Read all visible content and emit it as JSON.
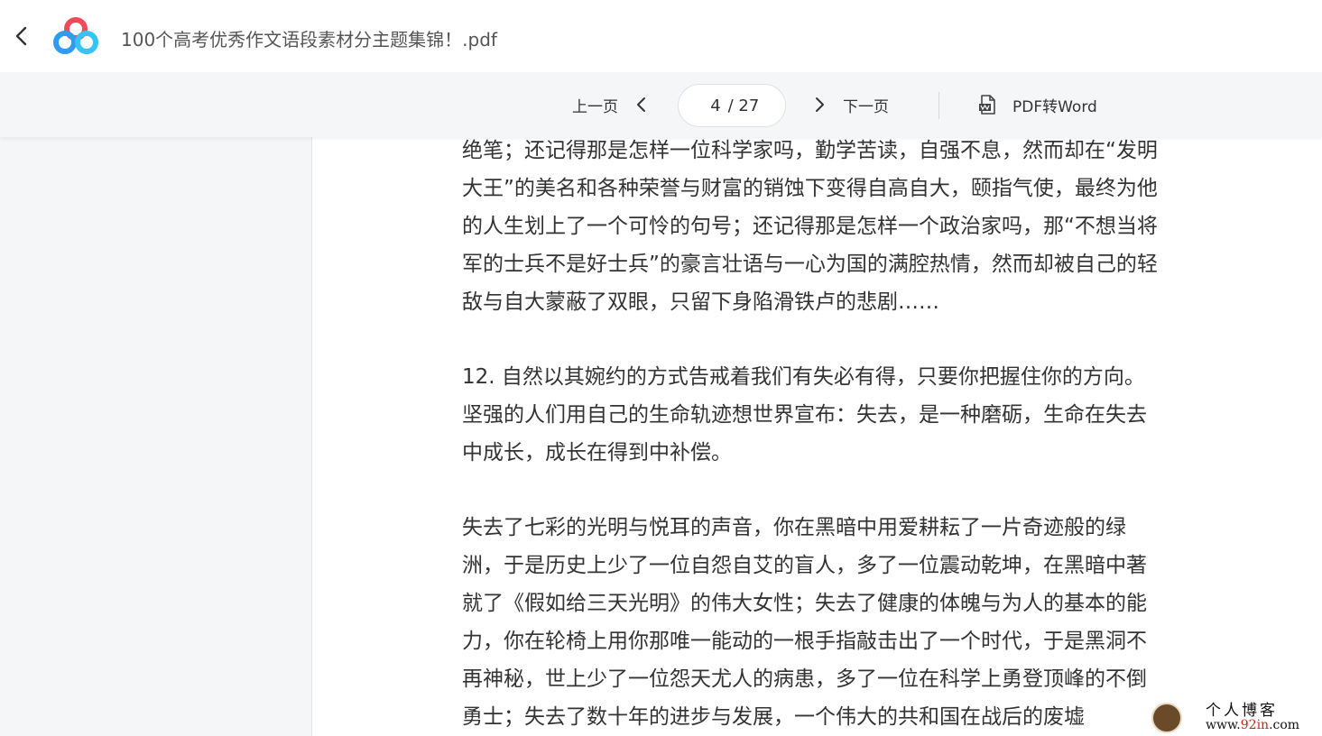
{
  "header": {
    "title": "100个高考优秀作文语段素材分主题集锦！.pdf"
  },
  "toolbar": {
    "prev_label": "上一页",
    "next_label": "下一页",
    "current_page": "4",
    "total_pages": "/ 27",
    "convert_label": "PDF转Word"
  },
  "content": {
    "paragraphs": [
      {
        "lines": [
          "绝笔；还记得那是怎样一位科学家吗，勤学苦读，自强不息，然而却在“发明",
          "大王”的美名和各种荣誉与财富的销蚀下变得自高自大，颐指气使，最终为他",
          "的人生划上了一个可怜的句号；还记得那是怎样一个政治家吗，那“不想当将",
          "军的士兵不是好士兵”的豪言壮语与一心为国的满腔热情，然而却被自己的轻",
          "敌与自大蒙蔽了双眼，只留下身陷滑铁卢的悲剧……"
        ]
      },
      {
        "lines": [
          "12. 自然以其婉约的方式告戒着我们有失必有得，只要你把握住你的方向。",
          "坚强的人们用自己的生命轨迹想世界宣布：失去，是一种磨砺，生命在失去",
          "中成长，成长在得到中补偿。"
        ]
      },
      {
        "lines": [
          "失去了七彩的光明与悦耳的声音，你在黑暗中用爱耕耘了一片奇迹般的绿",
          "洲，于是历史上少了一位自怨自艾的盲人，多了一位震动乾坤，在黑暗中著",
          "就了《假如给三天光明》的伟大女性；失去了健康的体魄与为人的基本的能",
          "力，你在轮椅上用你那唯一能动的一根手指敲击出了一个时代，于是黑洞不",
          "再神秘，世上少了一位怨天尤人的病患，多了一位在科学上勇登顶峰的不倒",
          "勇士；失去了数十年的进步与发展，一个伟大的共和国在战后的废墟"
        ]
      }
    ]
  },
  "watermark": {
    "title": "个人博客",
    "url_prefix": "www.",
    "url_accent": "92in",
    "url_suffix": ".com"
  },
  "colors": {
    "toolbar_bg": "#f5f6f7",
    "logo_blue": "#2f9bf5",
    "logo_red": "#ef4a5a",
    "text": "#333333"
  }
}
